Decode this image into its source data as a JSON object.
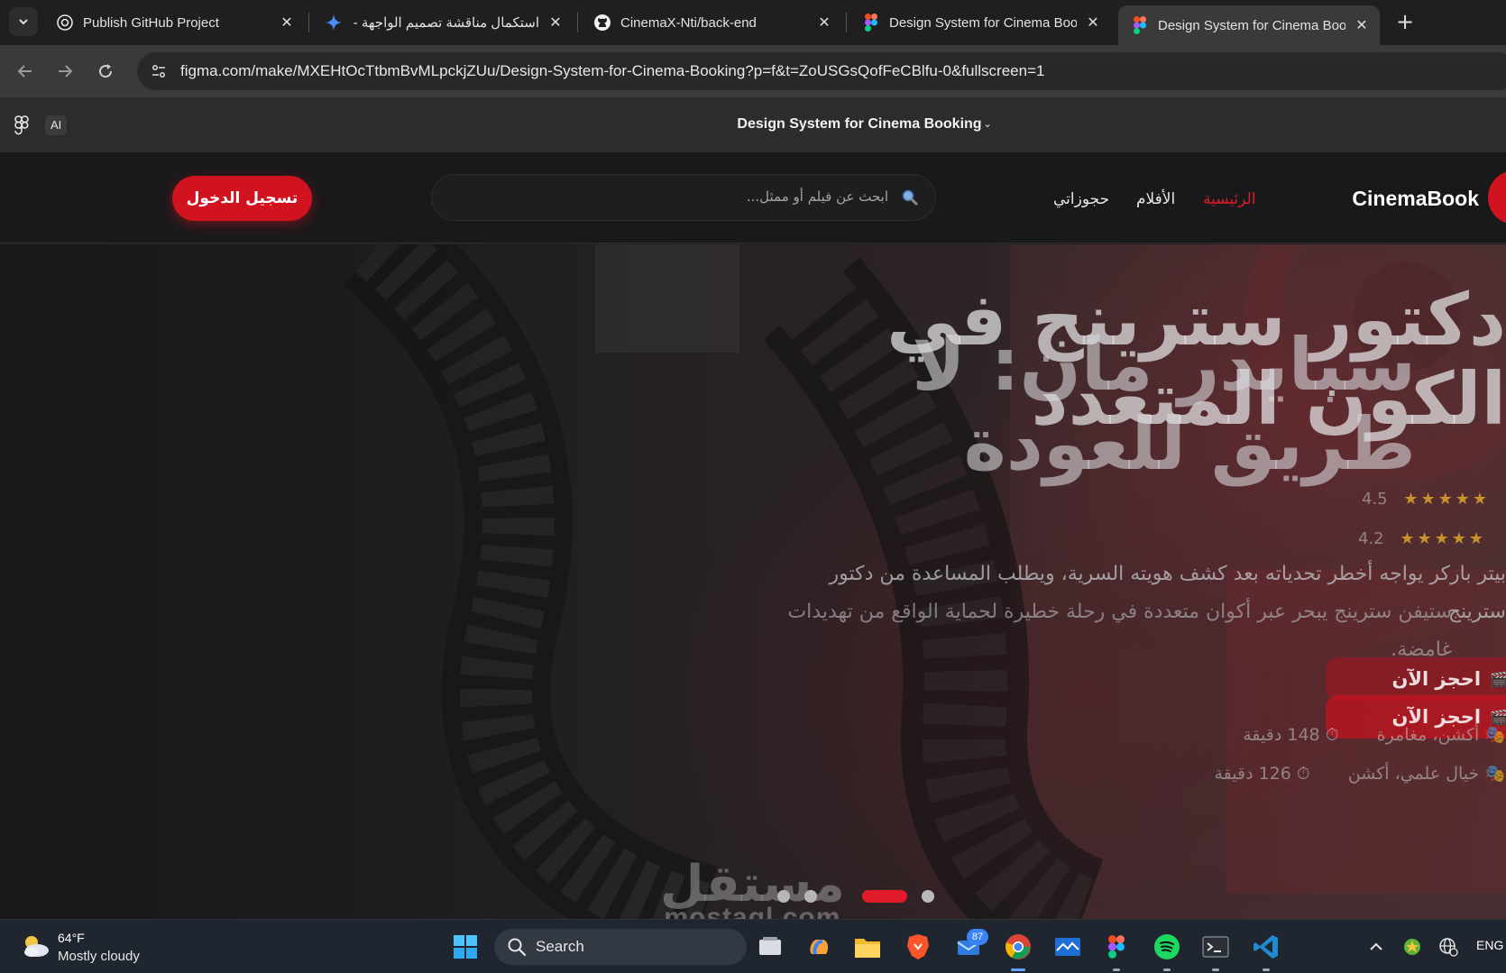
{
  "browser": {
    "tabs": [
      {
        "title": "Publish GitHub Project",
        "icon": "openai-icon",
        "active": false
      },
      {
        "title": "استكمال مناقشة تصميم الواجهة -",
        "icon": "gemini-icon",
        "active": false
      },
      {
        "title": "CinemaX-Nti/back-end",
        "icon": "github-icon",
        "active": false
      },
      {
        "title": "Design System for Cinema Book",
        "icon": "figma-icon",
        "active": false
      },
      {
        "title": "Design System for Cinema Book",
        "icon": "figma-icon",
        "active": true
      }
    ],
    "url": "figma.com/make/MXEHtOcTtbmBvMLpckjZUu/Design-System-for-Cinema-Booking?p=f&t=ZoUSGsQofFeCBlfu-0&fullscreen=1"
  },
  "figma_bar": {
    "ai_label": "AI",
    "file_title": "Design System for Cinema Booking"
  },
  "app": {
    "brand": "CinemaBook",
    "nav": {
      "home": "الرئيسية",
      "movies": "الأفلام",
      "bookings": "حجوزاتي"
    },
    "search_placeholder": "ابحث عن فيلم أو ممثل...",
    "login_label": "تسجيل الدخول",
    "accent_color": "#d1121f"
  },
  "hero": {
    "slide_a": {
      "title": "دكتور سترينج في الكون المتعدد",
      "rating": "4.5",
      "description": "ستيفن سترينج يبحر عبر أكوان متعددة في رحلة خطيرة لحماية الواقع من تهديدات غامضة.",
      "book_label": "احجز الآن",
      "genres": "خيال علمي، أكشن",
      "duration": "126 دقيقة"
    },
    "slide_b": {
      "title": "سبايدر مان: لا طريق للعودة",
      "rating": "4.2",
      "description": "بيتر باركر يواجه أخطر تحدياته بعد كشف هويته السرية، ويطلب المساعدة من دكتور سترينج",
      "book_label": "احجز الآن",
      "genres": "أكشن، مغامرة",
      "duration": "148 دقيقة"
    },
    "active_slide": 1,
    "slide_count": 4
  },
  "watermark": {
    "line1": "مستقل",
    "line2": "mostaql.com"
  },
  "taskbar": {
    "weather_temp": "64°F",
    "weather_desc": "Mostly cloudy",
    "search_label": "Search",
    "mail_badge": "87",
    "language": "ENG"
  }
}
